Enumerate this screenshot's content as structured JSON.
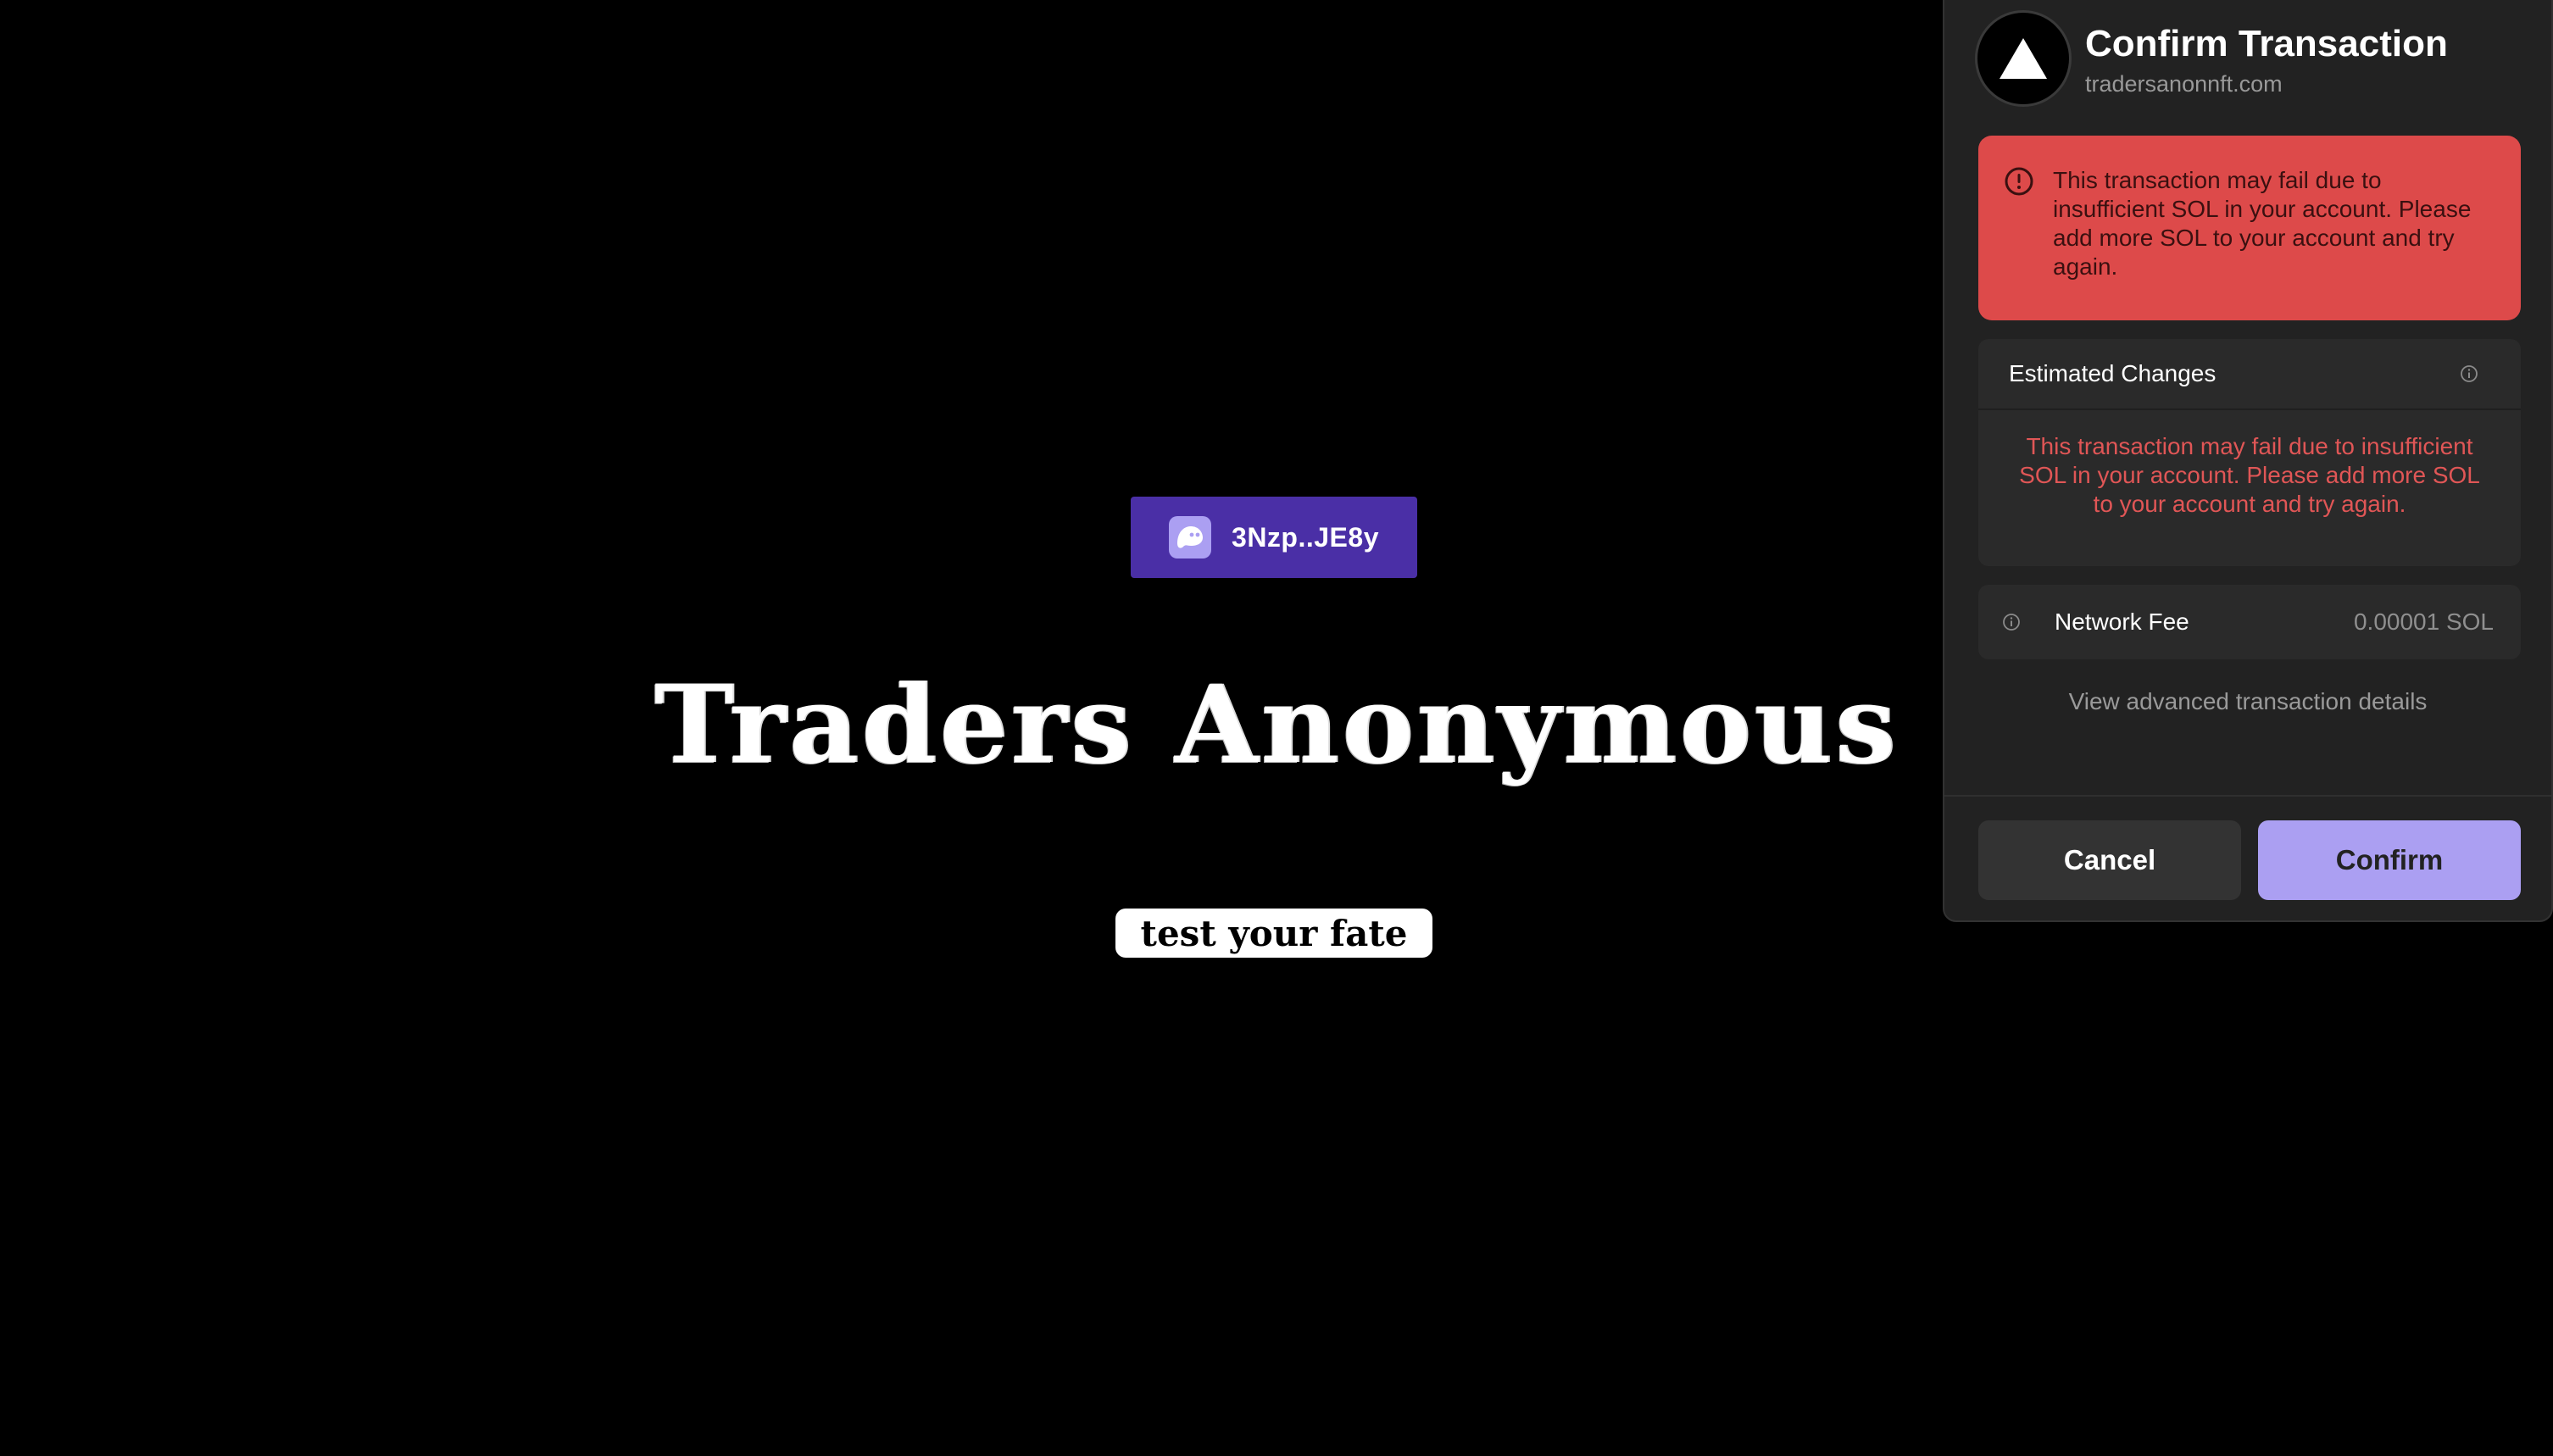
{
  "page": {
    "wallet_button": {
      "address": "3Nzp..JE8y",
      "icon": "ghost-icon"
    },
    "title": "Traders Anonymous",
    "tagline": "test your fate"
  },
  "popup": {
    "title": "Confirm Transaction",
    "origin": "tradersanonnft.com",
    "site_icon": "triangle-icon",
    "alert": {
      "icon": "exclamation-circle-icon",
      "message": "This transaction may fail due to insufficient SOL in your account. Please add more SOL to your account and try again."
    },
    "estimated_changes": {
      "title": "Estimated Changes",
      "info_icon": "info-icon",
      "message": "This transaction may fail due to insufficient SOL in your account. Please add more SOL to your account and try again."
    },
    "network_fee": {
      "label": "Network Fee",
      "value": "0.00001 SOL",
      "info_icon": "info-icon"
    },
    "advanced_link": "View advanced transaction details",
    "buttons": {
      "cancel": "Cancel",
      "confirm": "Confirm"
    }
  },
  "colors": {
    "background": "#000000",
    "wallet_button": "#4a2fa6",
    "popup_bg": "#222222",
    "alert_bg": "#dd4a4a",
    "alert_text": "#3a1010",
    "error_text": "#e05656",
    "confirm_button": "#ab9ff2",
    "cancel_button": "#333333"
  }
}
